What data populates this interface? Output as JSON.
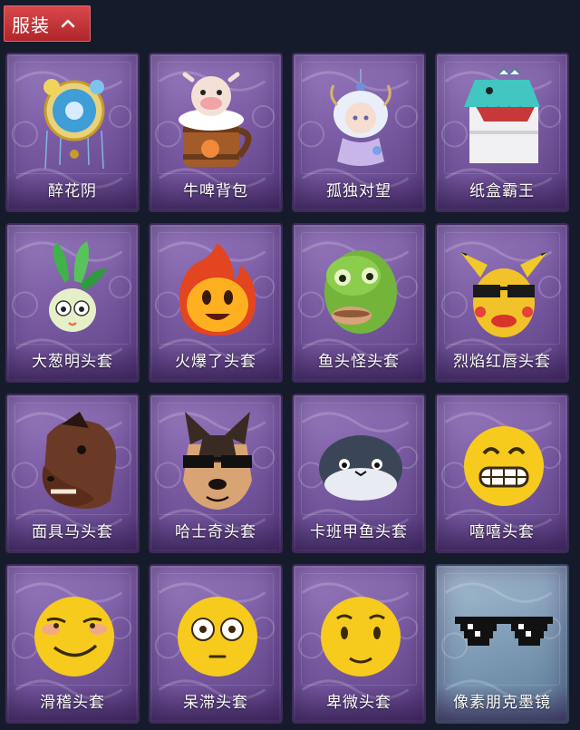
{
  "header": {
    "title": "服装",
    "toggle_icon": "chevron-up-icon"
  },
  "items": [
    {
      "name": "醉花阴",
      "icon": "dreamcatcher-ornament-icon",
      "rarity": "purple"
    },
    {
      "name": "牛啤背包",
      "icon": "cow-beer-mug-backpack-icon",
      "rarity": "purple"
    },
    {
      "name": "孤独对望",
      "icon": "fairy-doll-charm-icon",
      "rarity": "purple"
    },
    {
      "name": "纸盒霸王",
      "icon": "cardboard-dinosaur-head-icon",
      "rarity": "purple"
    },
    {
      "name": "大葱明头套",
      "icon": "scallion-head-icon",
      "rarity": "purple"
    },
    {
      "name": "火爆了头套",
      "icon": "fireball-head-icon",
      "rarity": "purple"
    },
    {
      "name": "鱼头怪头套",
      "icon": "fish-mask-head-icon",
      "rarity": "purple"
    },
    {
      "name": "烈焰红唇头套",
      "icon": "pikachu-sunglasses-head-icon",
      "rarity": "purple"
    },
    {
      "name": "面具马头套",
      "icon": "horse-mask-head-icon",
      "rarity": "purple"
    },
    {
      "name": "哈士奇头套",
      "icon": "husky-sunglasses-head-icon",
      "rarity": "purple"
    },
    {
      "name": "卡班甲鱼头套",
      "icon": "round-fish-head-icon",
      "rarity": "purple"
    },
    {
      "name": "嘻嘻头套",
      "icon": "grinning-emoji-head-icon",
      "rarity": "purple"
    },
    {
      "name": "滑稽头套",
      "icon": "smirk-emoji-head-icon",
      "rarity": "purple"
    },
    {
      "name": "呆滞头套",
      "icon": "flushed-emoji-head-icon",
      "rarity": "purple"
    },
    {
      "name": "卑微头套",
      "icon": "pleading-emoji-head-icon",
      "rarity": "purple"
    },
    {
      "name": "像素朋克墨镜",
      "icon": "pixel-sunglasses-icon",
      "rarity": "blue"
    }
  ]
}
